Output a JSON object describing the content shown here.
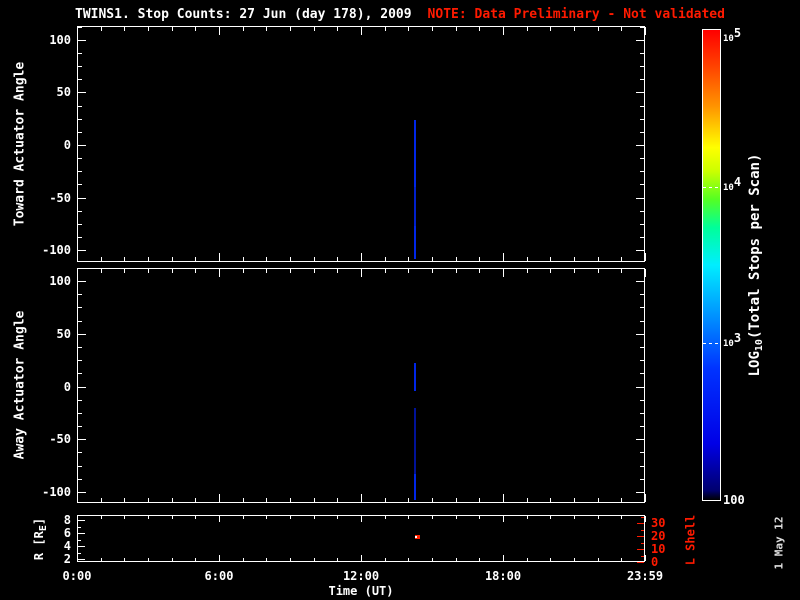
{
  "title": {
    "main": "TWINS1. Stop Counts: 27 Jun (day 178), 2009",
    "note": "NOTE: Data Preliminary - Not validated"
  },
  "date_stamp": "1 May 12",
  "colors": {
    "background": "#000000",
    "axis": "#ffffff",
    "note_red": "#ff1a00",
    "lshell_red": "#ff1a00",
    "line_bright": "#0026e8",
    "line_dim": "#001299",
    "dot_red": "#ff2200",
    "dot_core": "#ffffff"
  },
  "x_axis": {
    "label": "Time (UT)",
    "tick_labels": [
      "0:00",
      "6:00",
      "12:00",
      "18:00",
      "23:59"
    ],
    "tick_hours": [
      0,
      6,
      12,
      18,
      24
    ],
    "minor_step_hours": 1,
    "range_hours": [
      0,
      24
    ]
  },
  "colorbar": {
    "label_pre": "LOG",
    "label_sub": "10",
    "label_post": "(Total Stops per Scan)",
    "scale": "log",
    "range": [
      100,
      100000
    ],
    "tick_labels": [
      "10^5",
      "10^4",
      "10^3",
      "100"
    ],
    "tick_values": [
      100000,
      10000,
      1000,
      100
    ],
    "gradient": [
      {
        "pos": 0.0,
        "color": "#000000"
      },
      {
        "pos": 0.02,
        "color": "#00006e"
      },
      {
        "pos": 0.12,
        "color": "#0000e6"
      },
      {
        "pos": 0.28,
        "color": "#0033ff"
      },
      {
        "pos": 0.4,
        "color": "#0099ff"
      },
      {
        "pos": 0.5,
        "color": "#00eeff"
      },
      {
        "pos": 0.58,
        "color": "#00ff99"
      },
      {
        "pos": 0.64,
        "color": "#55ff22"
      },
      {
        "pos": 0.7,
        "color": "#ccff00"
      },
      {
        "pos": 0.75,
        "color": "#ffff00"
      },
      {
        "pos": 0.84,
        "color": "#ff9100"
      },
      {
        "pos": 0.93,
        "color": "#ff3c00"
      },
      {
        "pos": 1.0,
        "color": "#ff0000"
      }
    ]
  },
  "chart_data": [
    {
      "type": "heatmap",
      "name": "toward",
      "title": "Toward Actuator Angle vs Time",
      "ylabel": "Toward Actuator Angle",
      "yticks": [
        100,
        50,
        0,
        -50,
        -100
      ],
      "y_minor_step": 12.5,
      "ylim": [
        -111.4,
        113.3
      ],
      "xlim_hours": [
        0,
        24
      ],
      "segments": [
        {
          "time_hours": 14.3,
          "time_ut": "14:20",
          "angle_from": 24,
          "angle_to": -40,
          "color": "#0026e8",
          "stops_per_scan_approx": 400
        },
        {
          "time_hours": 14.3,
          "time_ut": "14:20",
          "angle_from": -40,
          "angle_to": -77,
          "color": "#0020cc",
          "stops_per_scan_approx": 250
        },
        {
          "time_hours": 14.3,
          "time_ut": "14:20",
          "angle_from": -77,
          "angle_to": -108,
          "color": "#0026e8",
          "stops_per_scan_approx": 400
        }
      ]
    },
    {
      "type": "heatmap",
      "name": "away",
      "title": "Away Actuator Angle vs Time",
      "ylabel": "Away Actuator Angle",
      "yticks": [
        100,
        50,
        0,
        -50,
        -100
      ],
      "y_minor_step": 12.5,
      "ylim": [
        -110.4,
        112.3
      ],
      "xlim_hours": [
        0,
        24
      ],
      "segments": [
        {
          "time_hours": 14.3,
          "time_ut": "14:20",
          "angle_from": 22,
          "angle_to": -5,
          "color": "#0026e8",
          "stops_per_scan_approx": 400
        },
        {
          "time_hours": 14.3,
          "time_ut": "14:20",
          "angle_from": -20,
          "angle_to": -83,
          "color": "#001299",
          "stops_per_scan_approx": 150
        },
        {
          "time_hours": 14.3,
          "time_ut": "14:20",
          "angle_from": -83,
          "angle_to": -108,
          "color": "#0026e8",
          "stops_per_scan_approx": 400
        }
      ]
    },
    {
      "type": "scatter",
      "name": "orbit",
      "ylabel_left": {
        "pre": "R [R",
        "sub": "E",
        "post": "]"
      },
      "ylabel_right": "L Shell",
      "yticks_left": [
        8,
        6,
        4,
        2
      ],
      "y_minor_step_left": 1,
      "ylim_left": [
        1.54,
        8.77
      ],
      "yticks_right": [
        30,
        20,
        10,
        0
      ],
      "y_minor_step_right": 5,
      "ylim_right": [
        0,
        36.2
      ],
      "points": [
        {
          "time_hours": 14.35,
          "time_ut": "14:21",
          "r_re": 5.4,
          "color": "#ff2200",
          "core_color": "#ffffff"
        }
      ]
    }
  ]
}
